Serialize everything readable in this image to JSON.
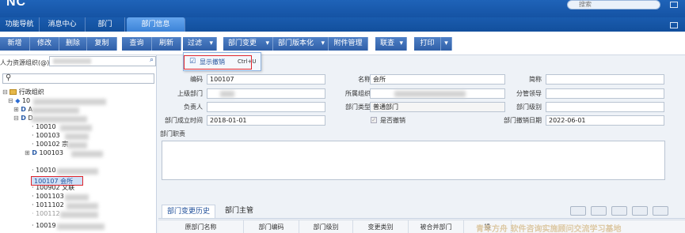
{
  "app": {
    "logo": "NC",
    "search_placeholder": "搜索"
  },
  "nav": {
    "tabs": [
      "功能导航",
      "消息中心",
      "部门",
      "部门信息"
    ],
    "active": "部门信息"
  },
  "toolbar": {
    "buttons": [
      "新增",
      "修改",
      "删除",
      "复制",
      "查询",
      "刷新"
    ],
    "filter": "过滤",
    "dept_change": "部门变更",
    "dept_version": "部门版本化",
    "attachment": "附件管理",
    "link": "联查",
    "print": "打印"
  },
  "filter_menu": {
    "item_label": "显示撤销",
    "shortcut": "Ctrl+U",
    "checked": true
  },
  "left": {
    "org_label": "人力资源组织(@)",
    "tree_root": "行政组织",
    "rows": [
      "10",
      "A",
      "D",
      "10010",
      "100103",
      "100102 宗",
      "100103",
      "10010",
      "100107 会所",
      "100902 文联",
      "1001103",
      "1011102",
      "100112",
      "10019"
    ],
    "selected": "100107 会所"
  },
  "form": {
    "code_label": "编码",
    "code_value": "100107",
    "name_label": "名称",
    "name_value": "会所",
    "short_label": "简称",
    "parent_label": "上级部门",
    "org_label": "所属组织",
    "leader_label": "分管领导",
    "manager_label": "负责人",
    "type_label": "部门类型",
    "type_value": "普通部门",
    "level_label": "部门级别",
    "estab_label": "部门成立时间",
    "estab_value": "2018-01-01",
    "revoked_label": "是否撤销",
    "revoke_date_label": "部门撤销日期",
    "revoke_date_value": "2022-06-01",
    "duty_label": "部门职责"
  },
  "bottom": {
    "tabs": [
      "部门变更历史",
      "部门主管"
    ],
    "columns": [
      "原部门名称",
      "部门编码",
      "部门级别",
      "变更类别",
      "被合并部门",
      "操"
    ]
  },
  "watermark": "青年方舟 软件咨询实施顾问交流学习基地"
}
